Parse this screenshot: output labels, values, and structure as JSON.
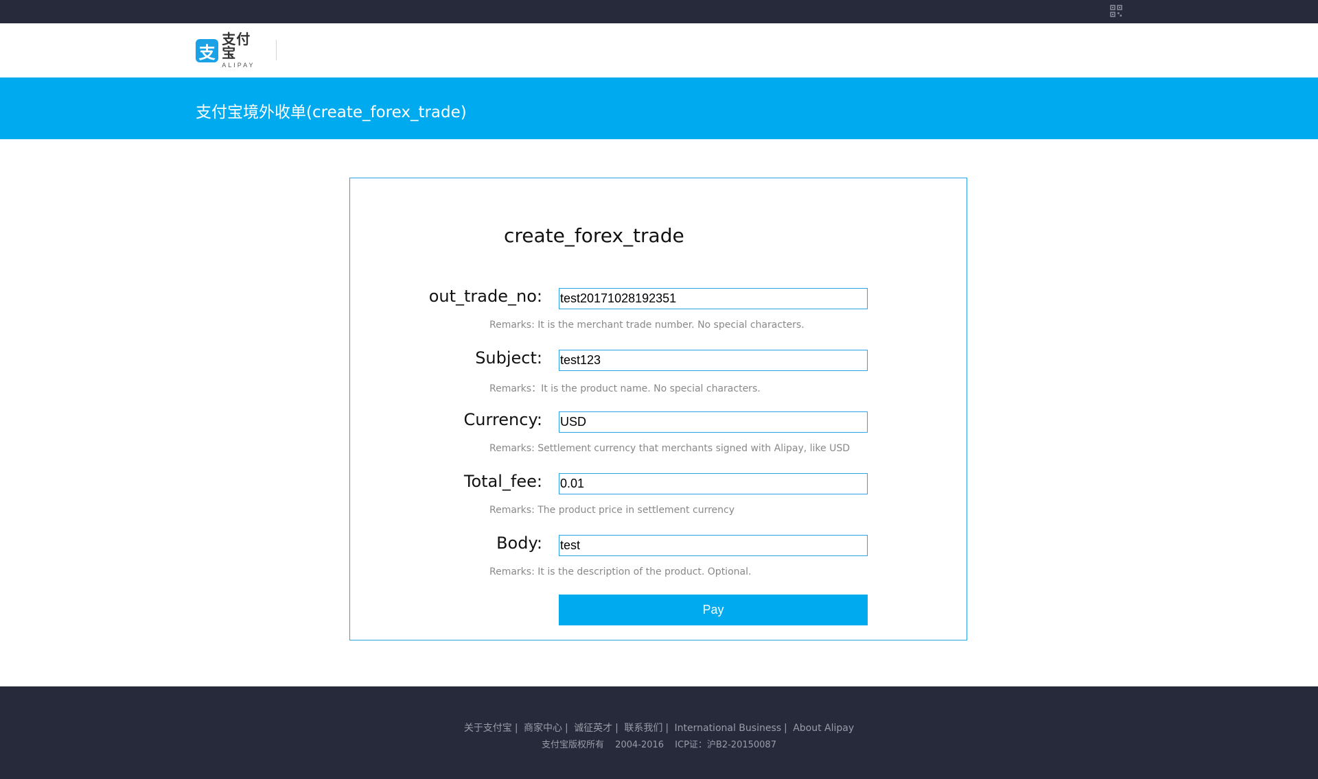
{
  "header": {
    "logo_cn": "支付宝",
    "logo_en": "ALIPAY",
    "logo_mark": "支",
    "topbar_icon": "qr-code-icon"
  },
  "banner": {
    "title": "支付宝境外收单(create_forex_trade)"
  },
  "form": {
    "title": "create_forex_trade",
    "fields": [
      {
        "label": "out_trade_no:",
        "value": "test20171028192351",
        "remark": "Remarks: It is the merchant trade number. No special characters."
      },
      {
        "label": "Subject:",
        "value": "test123",
        "remark": "Remarks：It is the product name. No special characters."
      },
      {
        "label": "Currency:",
        "value": "USD",
        "remark": "Remarks: Settlement currency that merchants signed with Alipay, like USD"
      },
      {
        "label": "Total_fee:",
        "value": "0.01",
        "remark": "Remarks: The product price in settlement currency"
      },
      {
        "label": "Body:",
        "value": "test",
        "remark": "Remarks: It is the description of the product. Optional."
      }
    ],
    "submit_label": "Pay"
  },
  "footer": {
    "links": [
      "关于支付宝",
      "商家中心",
      "诚征英才",
      "联系我们",
      "International Business",
      "About Alipay"
    ],
    "separator": "|",
    "copyright": "支付宝版权所有",
    "years": "2004-2016",
    "icp": "ICP证：沪B2-20150087"
  },
  "colors": {
    "accent": "#00aaee",
    "dark": "#262a3b",
    "border": "#26a4e6"
  }
}
